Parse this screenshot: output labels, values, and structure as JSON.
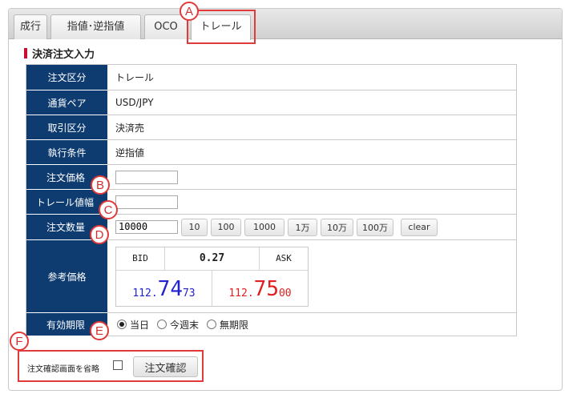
{
  "tabs": [
    "成行",
    "指値･逆指値",
    "OCO",
    "トレール"
  ],
  "section_title": "決済注文入力",
  "rows": {
    "order_type": {
      "label": "注文区分",
      "value": "トレール"
    },
    "pair": {
      "label": "通貨ペア",
      "value": "USD/JPY"
    },
    "trade_type": {
      "label": "取引区分",
      "value": "決済売"
    },
    "exec_cond": {
      "label": "執行条件",
      "value": "逆指値"
    },
    "price": {
      "label": "注文価格",
      "value": ""
    },
    "trail": {
      "label": "トレール値幅",
      "value": ""
    },
    "qty": {
      "label": "注文数量",
      "value": "10000",
      "buttons": [
        "10",
        "100",
        "1000",
        "1万",
        "10万",
        "100万"
      ],
      "clear": "clear"
    },
    "ref": {
      "label": "参考価格"
    },
    "expiry": {
      "label": "有効期限",
      "options": [
        "当日",
        "今週末",
        "無期限"
      ],
      "selected": "当日"
    }
  },
  "quote": {
    "bid_label": "BID",
    "spread": "0.27",
    "ask_label": "ASK",
    "bid": {
      "head": "112.",
      "big": "74",
      "small": "73"
    },
    "ask": {
      "head": "112.",
      "big": "75",
      "small": "00"
    },
    "bid_color": "#2222cc",
    "ask_color": "#e02020"
  },
  "footer": {
    "skip_label": "注文確認画面を省略",
    "confirm": "注文確認"
  },
  "markers": [
    "A",
    "B",
    "C",
    "D",
    "E",
    "F"
  ],
  "colors": {
    "header_bg": "#0e3c70",
    "marker": "#e03a3a"
  }
}
